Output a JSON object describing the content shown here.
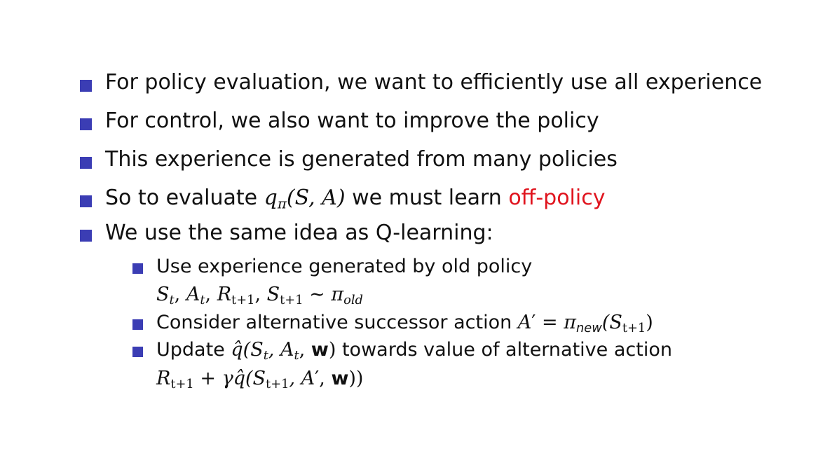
{
  "bullets": [
    {
      "text": "For policy evaluation, we want to efficiently use all experience"
    },
    {
      "text": "For control, we also want to improve the policy"
    },
    {
      "text": "This experience is generated from many policies"
    },
    {
      "pre": "So to evaluate ",
      "q": "q",
      "q_sub": "π",
      "args": "(S, A)",
      "post": " we must learn ",
      "highlight": "off-policy"
    },
    {
      "text": "We use the same idea as Q-learning:"
    }
  ],
  "subbullets": [
    {
      "text": "Use experience generated by old policy",
      "math": {
        "s1": "S",
        "s1_sub": "t",
        "a1": "A",
        "a1_sub": "t",
        "r": "R",
        "r_sub": "t+1",
        "s2": "S",
        "s2_sub": "t+1",
        "tilde": "∼",
        "pi": "π",
        "pi_sub": "old"
      }
    },
    {
      "pre": "Consider alternative successor action ",
      "a": "A",
      "prime": "′",
      "eq": " = ",
      "pi": "π",
      "pi_sub": "new",
      "s": "(S",
      "s_sub": "t+1",
      "close": ")"
    },
    {
      "pre": "Update ",
      "q": "q̂",
      "args_pre": "(S",
      "s_sub": "t",
      "mid": ", A",
      "a_sub": "t",
      "w_sep": ", ",
      "w": "w",
      "args_close": ")",
      "post": " towards value of alternative action",
      "math": {
        "r": "R",
        "r_sub": "t+1",
        "plus": " + ",
        "gamma": "γ",
        "q": "q̂",
        "open": "(S",
        "s_sub": "t+1",
        "a": ", A",
        "prime": "′",
        "w_sep": ", ",
        "w": "w",
        "close": "))"
      }
    }
  ],
  "colors": {
    "bullet": "#3b3db4",
    "highlight": "#e0141e"
  }
}
